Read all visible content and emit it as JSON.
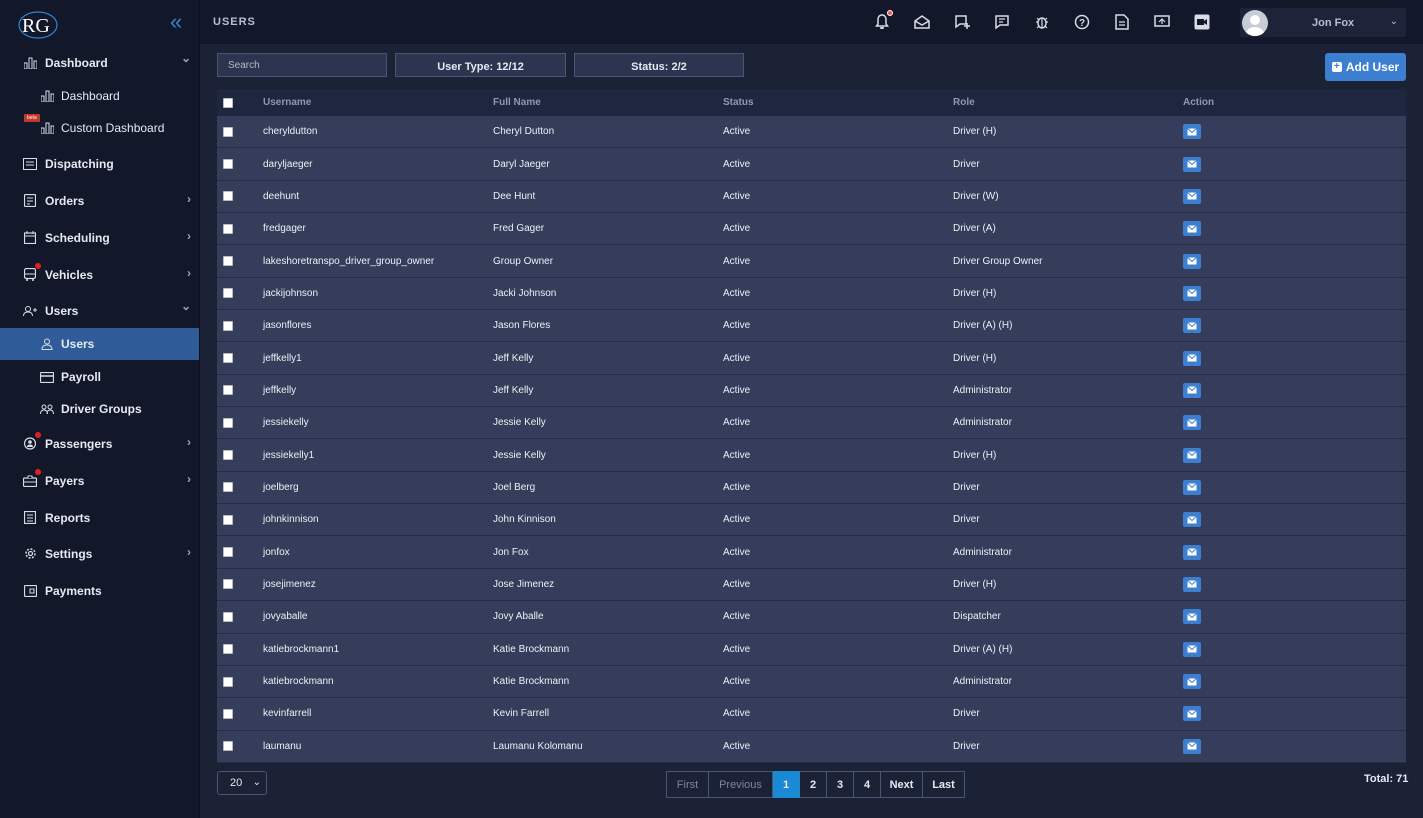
{
  "app": {
    "logo_text": "RG"
  },
  "header": {
    "title": "USERS",
    "user_name": "Jon Fox"
  },
  "sidebar": {
    "items": [
      {
        "label": "Dashboard",
        "icon": "bar-chart-icon",
        "expanded": true
      },
      {
        "label": "Dashboard",
        "icon": "bar-chart-icon",
        "sub": true
      },
      {
        "label": "Custom Dashboard",
        "icon": "bar-chart-icon",
        "sub": true,
        "badge": "beta"
      },
      {
        "label": "Dispatching",
        "icon": "dispatch-icon"
      },
      {
        "label": "Orders",
        "icon": "orders-icon"
      },
      {
        "label": "Scheduling",
        "icon": "calendar-icon"
      },
      {
        "label": "Vehicles",
        "icon": "bus-icon"
      },
      {
        "label": "Users",
        "icon": "users-icon",
        "expanded": true
      },
      {
        "label": "Users",
        "icon": "user-icon",
        "sub": true,
        "active": true
      },
      {
        "label": "Payroll",
        "icon": "card-icon",
        "sub": true
      },
      {
        "label": "Driver Groups",
        "icon": "group-icon",
        "sub": true
      },
      {
        "label": "Passengers",
        "icon": "passenger-icon"
      },
      {
        "label": "Payers",
        "icon": "briefcase-icon"
      },
      {
        "label": "Reports",
        "icon": "reports-icon"
      },
      {
        "label": "Settings",
        "icon": "gear-icon"
      },
      {
        "label": "Payments",
        "icon": "payments-icon"
      }
    ]
  },
  "filters": {
    "search_placeholder": "Search",
    "user_type": "User Type: 12/12",
    "status": "Status: 2/2",
    "add_user": "Add User"
  },
  "table": {
    "headers": {
      "username": "Username",
      "full_name": "Full Name",
      "status": "Status",
      "role": "Role",
      "action": "Action"
    },
    "rows": [
      {
        "username": "cheryldutton",
        "full_name": "Cheryl Dutton",
        "status": "Active",
        "role": "Driver (H)"
      },
      {
        "username": "daryljaeger",
        "full_name": "Daryl Jaeger",
        "status": "Active",
        "role": "Driver"
      },
      {
        "username": "deehunt",
        "full_name": "Dee Hunt",
        "status": "Active",
        "role": "Driver (W)"
      },
      {
        "username": "fredgager",
        "full_name": "Fred Gager",
        "status": "Active",
        "role": "Driver (A)"
      },
      {
        "username": "lakeshoretranspo_driver_group_owner",
        "full_name": "Group Owner",
        "status": "Active",
        "role": "Driver Group Owner"
      },
      {
        "username": "jackijohnson",
        "full_name": "Jacki Johnson",
        "status": "Active",
        "role": "Driver (H)"
      },
      {
        "username": "jasonflores",
        "full_name": "Jason Flores",
        "status": "Active",
        "role": "Driver (A) (H)"
      },
      {
        "username": "jeffkelly1",
        "full_name": "Jeff Kelly",
        "status": "Active",
        "role": "Driver (H)"
      },
      {
        "username": "jeffkelly",
        "full_name": "Jeff Kelly",
        "status": "Active",
        "role": "Administrator"
      },
      {
        "username": "jessiekelly",
        "full_name": "Jessie Kelly",
        "status": "Active",
        "role": "Administrator"
      },
      {
        "username": "jessiekelly1",
        "full_name": "Jessie Kelly",
        "status": "Active",
        "role": "Driver (H)"
      },
      {
        "username": "joelberg",
        "full_name": "Joel Berg",
        "status": "Active",
        "role": "Driver"
      },
      {
        "username": "johnkinnison",
        "full_name": "John Kinnison",
        "status": "Active",
        "role": "Driver"
      },
      {
        "username": "jonfox",
        "full_name": "Jon Fox",
        "status": "Active",
        "role": "Administrator"
      },
      {
        "username": "josejimenez",
        "full_name": "Jose Jimenez",
        "status": "Active",
        "role": "Driver (H)"
      },
      {
        "username": "jovyaballe",
        "full_name": "Jovy Aballe",
        "status": "Active",
        "role": "Dispatcher"
      },
      {
        "username": "katiebrockmann1",
        "full_name": "Katie Brockmann",
        "status": "Active",
        "role": "Driver (A) (H)"
      },
      {
        "username": "katiebrockmann",
        "full_name": "Katie Brockmann",
        "status": "Active",
        "role": "Administrator"
      },
      {
        "username": "kevinfarrell",
        "full_name": "Kevin Farrell",
        "status": "Active",
        "role": "Driver"
      },
      {
        "username": "laumanu",
        "full_name": "Laumanu Kolomanu",
        "status": "Active",
        "role": "Driver"
      }
    ]
  },
  "pagination": {
    "per_page": "20",
    "first": "First",
    "previous": "Previous",
    "pages": [
      "1",
      "2",
      "3",
      "4"
    ],
    "current_page": "1",
    "next": "Next",
    "last": "Last",
    "total": "Total: 71"
  },
  "colors": {
    "accent": "#3c7fd0",
    "active_nav": "#2f5c99",
    "page_active": "#1a8ad4",
    "notification": "#e02020"
  }
}
